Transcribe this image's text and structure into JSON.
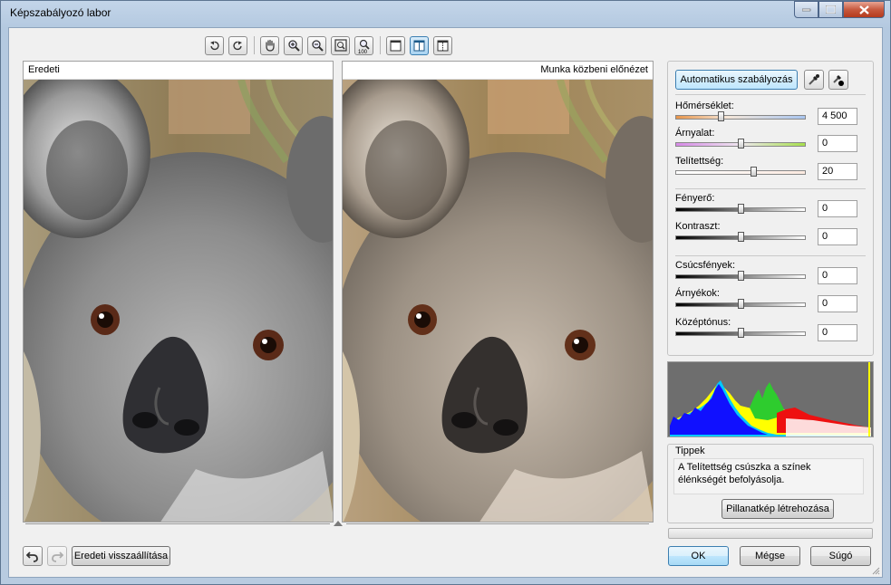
{
  "window": {
    "title": "Képszabályozó labor"
  },
  "panes": {
    "left_caption": "Eredeti",
    "right_caption": "Munka közbeni előnézet"
  },
  "toolbar": {
    "icons": [
      "rotate-left-icon",
      "rotate-right-icon",
      "pan-hand-icon",
      "zoom-in-icon",
      "zoom-out-icon",
      "fit-to-window-icon",
      "zoom-100-icon",
      "single-view-icon",
      "split-view-icon",
      "side-by-side-view-icon"
    ],
    "zoom_badge": "100"
  },
  "adjust": {
    "auto_button": "Automatikus szabályozás",
    "sliders": [
      {
        "label": "Hőmérséklet:",
        "value": "4 500",
        "level": 0.35
      },
      {
        "label": "Árnyalat:",
        "value": "0",
        "level": 0.5
      },
      {
        "label": "Telítettség:",
        "value": "20",
        "level": 0.6
      },
      {
        "label": "Fényerő:",
        "value": "0",
        "level": 0.5
      },
      {
        "label": "Kontraszt:",
        "value": "0",
        "level": 0.5
      },
      {
        "label": "Csúcsfények:",
        "value": "0",
        "level": 0.5
      },
      {
        "label": "Árnyékok:",
        "value": "0",
        "level": 0.5
      },
      {
        "label": "Középtónus:",
        "value": "0",
        "level": 0.5
      }
    ]
  },
  "tips": {
    "title": "Tippek",
    "text": "A Telítettség csúszka a színek élénkségét befolyásolja.",
    "snapshot_button": "Pillanatkép létrehozása"
  },
  "footer": {
    "reset_button": "Eredeti visszaállítása",
    "ok": "OK",
    "cancel": "Mégse",
    "help": "Súgó"
  },
  "colors": {
    "accent": "#3c7fb1",
    "temperature_left": "#e8954a",
    "temperature_right": "#a9c6f0",
    "tint_left": "#d68ae6",
    "tint_right": "#a7e04c"
  }
}
